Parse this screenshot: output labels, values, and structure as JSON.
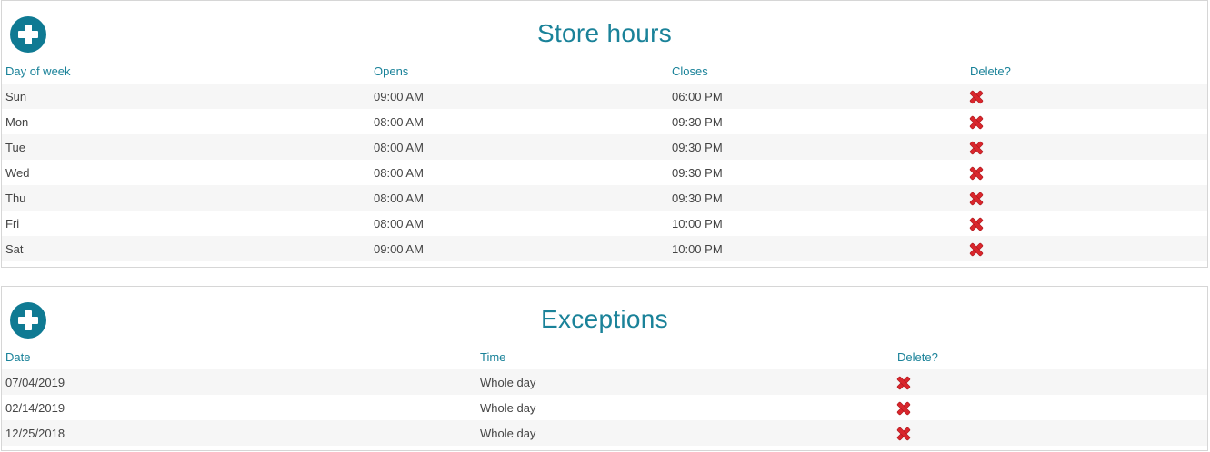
{
  "store_hours": {
    "title": "Store hours",
    "columns": [
      "Day of week",
      "Opens",
      "Closes",
      "Delete?"
    ],
    "rows": [
      {
        "day": "Sun",
        "opens": "09:00 AM",
        "closes": "06:00 PM"
      },
      {
        "day": "Mon",
        "opens": "08:00 AM",
        "closes": "09:30 PM"
      },
      {
        "day": "Tue",
        "opens": "08:00 AM",
        "closes": "09:30 PM"
      },
      {
        "day": "Wed",
        "opens": "08:00 AM",
        "closes": "09:30 PM"
      },
      {
        "day": "Thu",
        "opens": "08:00 AM",
        "closes": "09:30 PM"
      },
      {
        "day": "Fri",
        "opens": "08:00 AM",
        "closes": "10:00 PM"
      },
      {
        "day": "Sat",
        "opens": "09:00 AM",
        "closes": "10:00 PM"
      }
    ]
  },
  "exceptions": {
    "title": "Exceptions",
    "columns": [
      "Date",
      "Time",
      "Delete?"
    ],
    "rows": [
      {
        "date": "07/04/2019",
        "time": "Whole day"
      },
      {
        "date": "02/14/2019",
        "time": "Whole day"
      },
      {
        "date": "12/25/2018",
        "time": "Whole day"
      }
    ]
  },
  "icons": {
    "add": "plus-circle-icon",
    "delete": "red-x-icon"
  },
  "colors": {
    "accent": "#0f7a93",
    "header_text": "#1a8299",
    "delete": "#d9262c",
    "row_stripe": "#f6f6f6"
  }
}
